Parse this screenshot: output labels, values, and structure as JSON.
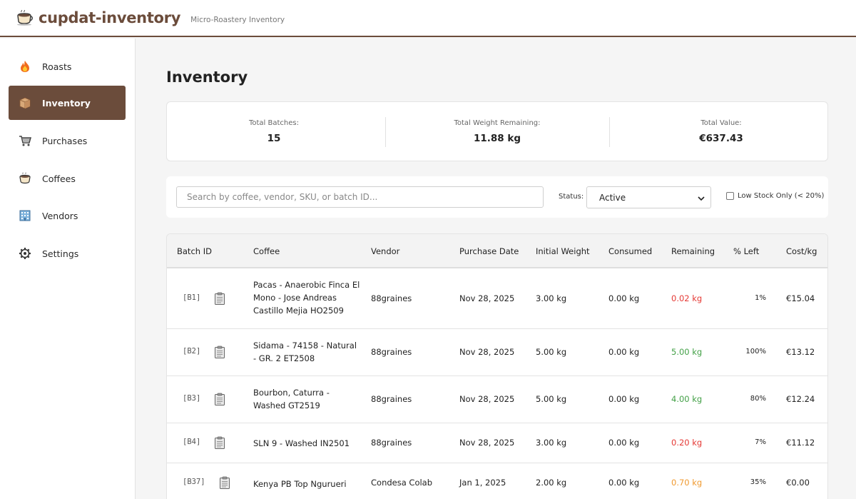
{
  "app": {
    "name": "cupdat-inventory",
    "subtitle": "Micro-Roastery Inventory"
  },
  "sidebar": {
    "items": [
      {
        "label": "Roasts",
        "icon": "fire-icon",
        "active": false
      },
      {
        "label": "Inventory",
        "icon": "box-icon",
        "active": true
      },
      {
        "label": "Purchases",
        "icon": "cart-icon",
        "active": false
      },
      {
        "label": "Coffees",
        "icon": "coffee-cup-icon",
        "active": false
      },
      {
        "label": "Vendors",
        "icon": "building-icon",
        "active": false
      },
      {
        "label": "Settings",
        "icon": "gear-icon",
        "active": false
      }
    ]
  },
  "page": {
    "title": "Inventory"
  },
  "stats": {
    "total_batches_label": "Total Batches:",
    "total_batches": "15",
    "total_weight_label": "Total Weight Remaining:",
    "total_weight": "11.88 kg",
    "total_value_label": "Total Value:",
    "total_value": "€637.43"
  },
  "filters": {
    "search_placeholder": "Search by coffee, vendor, SKU, or batch ID...",
    "status_label": "Status:",
    "status_value": "Active",
    "low_stock_label": "Low Stock Only (< 20%)",
    "low_stock_checked": false
  },
  "table": {
    "columns": [
      "Batch ID",
      "Coffee",
      "Vendor",
      "Purchase Date",
      "Initial Weight",
      "Consumed",
      "Remaining",
      "% Left",
      "Cost/kg"
    ],
    "rows": [
      {
        "batch_id": "[B1]",
        "coffee": "Pacas - Anaerobic Finca El Mono - Jose Andreas Castillo Mejia HO2509",
        "vendor": "88graines",
        "purchase_date": "Nov 28, 2025",
        "initial_weight": "3.00 kg",
        "consumed": "0.00 kg",
        "remaining": "0.02 kg",
        "remaining_level": "low",
        "pct_left": "1%",
        "cost_per_kg": "€15.04"
      },
      {
        "batch_id": "[B2]",
        "coffee": "Sidama - 74158 - Natural - GR. 2 ET2508",
        "vendor": "88graines",
        "purchase_date": "Nov 28, 2025",
        "initial_weight": "5.00 kg",
        "consumed": "0.00 kg",
        "remaining": "5.00 kg",
        "remaining_level": "high",
        "pct_left": "100%",
        "cost_per_kg": "€13.12"
      },
      {
        "batch_id": "[B3]",
        "coffee": "Bourbon, Caturra - Washed GT2519",
        "vendor": "88graines",
        "purchase_date": "Nov 28, 2025",
        "initial_weight": "5.00 kg",
        "consumed": "0.00 kg",
        "remaining": "4.00 kg",
        "remaining_level": "high",
        "pct_left": "80%",
        "cost_per_kg": "€12.24"
      },
      {
        "batch_id": "[B4]",
        "coffee": "SLN 9 - Washed IN2501",
        "vendor": "88graines",
        "purchase_date": "Nov 28, 2025",
        "initial_weight": "3.00 kg",
        "consumed": "0.00 kg",
        "remaining": "0.20 kg",
        "remaining_level": "low",
        "pct_left": "7%",
        "cost_per_kg": "€11.12"
      },
      {
        "batch_id": "[B37]",
        "coffee": "Kenya PB Top Ngurueri",
        "vendor": "Condesa Colab",
        "purchase_date": "Jan 1, 2025",
        "initial_weight": "2.00 kg",
        "consumed": "0.00 kg",
        "remaining": "0.70 kg",
        "remaining_level": "medium",
        "pct_left": "35%",
        "cost_per_kg": "€0.00"
      }
    ]
  },
  "colors": {
    "brand": "#6b4c3b",
    "low": "#e53935",
    "high": "#43a047",
    "medium": "#f09a30"
  }
}
